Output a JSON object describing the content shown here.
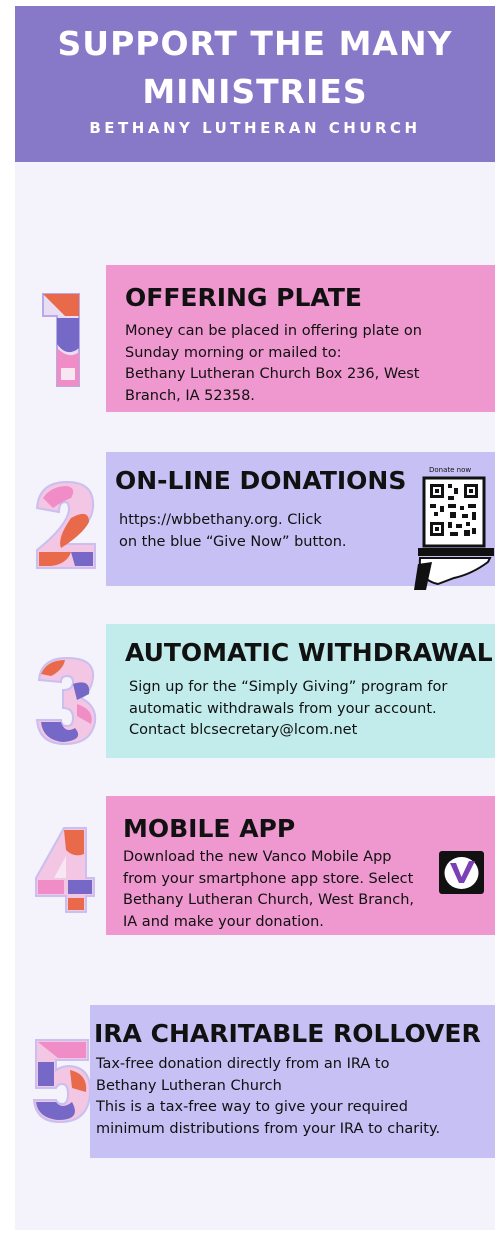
{
  "header": {
    "title_line1": "SUPPORT THE MANY",
    "title_line2": "MINISTRIES",
    "subtitle": "BETHANY LUTHERAN CHURCH"
  },
  "items": [
    {
      "number": "1",
      "title": "OFFERING PLATE",
      "lines": [
        "Money can be placed in offering plate on",
        "Sunday morning or mailed to:",
        "Bethany Lutheran Church Box 236, West",
        "Branch, IA   52358."
      ],
      "color": "#ef97cf"
    },
    {
      "number": "2",
      "title": "ON-LINE DONATIONS",
      "lines": [
        "https://wbbethany.org. Click",
        "on the blue “Give Now” button."
      ],
      "qr_caption": "Donate now",
      "color": "#c7c0f4"
    },
    {
      "number": "3",
      "title": "AUTOMATIC WITHDRAWAL",
      "lines": [
        "Sign up for the “Simply Giving” program for",
        "automatic withdrawals from your account.",
        "Contact blcsecretary@lcom.net"
      ],
      "color": "#c2ecec"
    },
    {
      "number": "4",
      "title": "MOBILE APP",
      "lines": [
        "Download the new Vanco Mobile App",
        "from your smartphone app store. Select",
        "Bethany Lutheran Church, West Branch,",
        "IA and make your donation."
      ],
      "color": "#ef97cf"
    },
    {
      "number": "5",
      "title": "IRA CHARITABLE ROLLOVER",
      "lines": [
        "Tax-free donation directly from an IRA to",
        "Bethany Lutheran Church",
        "This is a tax-free way to give your required",
        "minimum distributions from your IRA to charity."
      ],
      "color": "#c7c0f4"
    }
  ]
}
